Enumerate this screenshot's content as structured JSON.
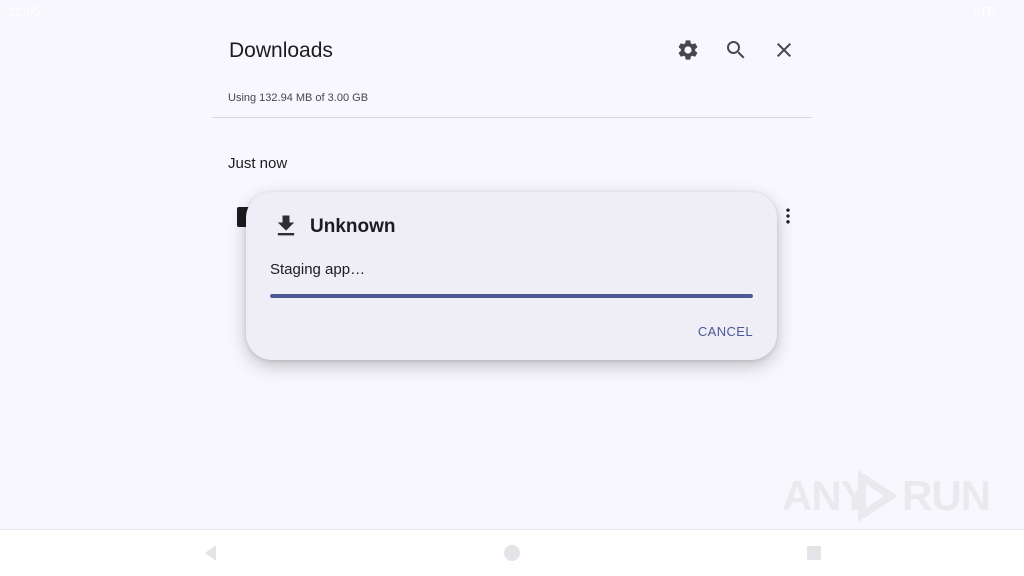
{
  "status_bar": {
    "left": "12:05",
    "right": "LTE"
  },
  "header": {
    "title": "Downloads",
    "usage": "Using 132.94 MB of 3.00 GB",
    "icons": [
      "settings-icon",
      "search-icon",
      "close-icon"
    ]
  },
  "list": {
    "section_label": "Just now"
  },
  "dialog": {
    "icon": "download-icon",
    "title": "Unknown",
    "message": "Staging app…",
    "progress": 1.0,
    "cancel_label": "CANCEL"
  },
  "watermark": {
    "left": "ANY",
    "right": "RUN"
  },
  "nav_bar": {
    "buttons": [
      "back-icon",
      "home-icon",
      "recents-icon"
    ]
  },
  "colors": {
    "background": "#f8f7fd",
    "dialog": "#efeef6",
    "accent": "#4a5a96",
    "progress_track": "#d6d9ef"
  }
}
